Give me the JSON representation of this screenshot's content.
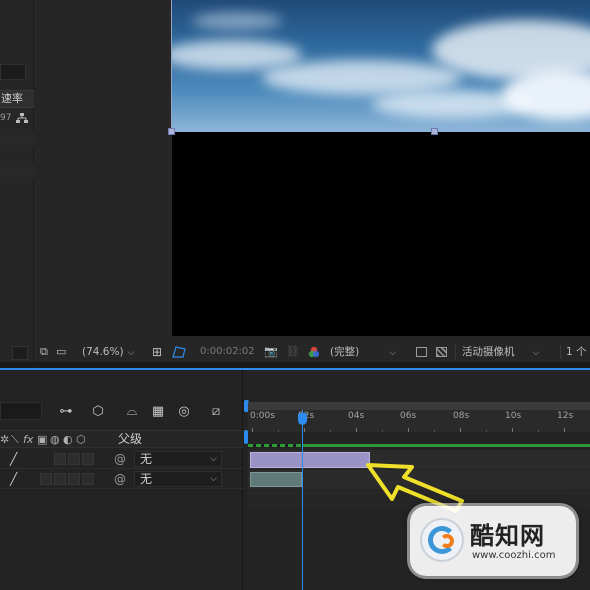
{
  "project_panel": {
    "column_header": "速率",
    "row_value": "97"
  },
  "viewer_toolbar": {
    "zoom": "(74.6%)",
    "timecode": "0:00:02:02",
    "resolution": "(完整)",
    "camera": "活动摄像机",
    "views": "1 个"
  },
  "timeline": {
    "header": {
      "parent_label": "父级"
    },
    "ruler_labels": [
      "0:00s",
      "02s",
      "04s",
      "06s",
      "08s",
      "10s",
      "12s"
    ],
    "layers": [
      {
        "parent": "无"
      },
      {
        "parent": "无"
      }
    ]
  },
  "watermark": {
    "title": "酷知网",
    "url": "www.coozhi.com"
  },
  "colors": {
    "accent_blue": "#2d8ceb",
    "clip_purple": "#9a93c5",
    "clip_teal": "#5f7a78",
    "work_area_green": "#2d9a36"
  }
}
